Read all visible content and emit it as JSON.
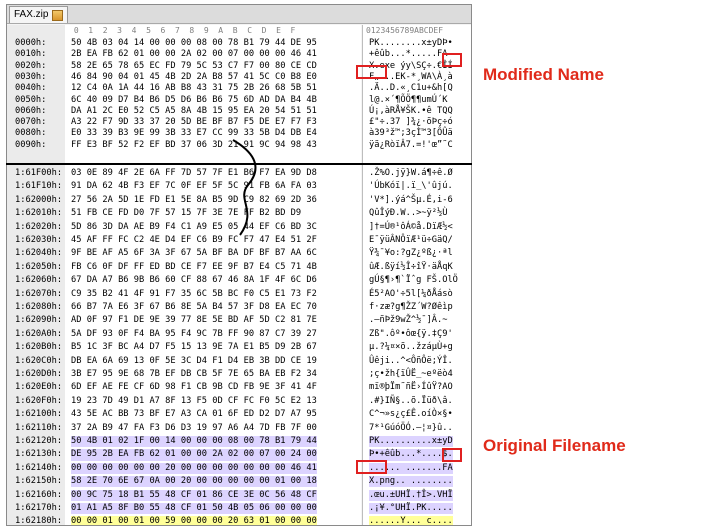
{
  "window": {
    "tab_title": "FAX.zip",
    "tab_icon": "archive-icon"
  },
  "header": {
    "offset_label": "",
    "hex_cols": " 0  1  2  3  4  5  6  7  8  9  A  B  C  D  E  F",
    "ascii_cols": "0123456789ABCDEF"
  },
  "top_rows": [
    {
      "offset": "0000h:",
      "hex": "50 4B 03 04 14 00 00 00 08 00 78 B1 79 44 DE 95",
      "ascii": "PK........x±yDÞ•"
    },
    {
      "offset": "0010h:",
      "hex": "2B EA FB 62 01 00 00 2A 02 00 07 00 00 00 46 41",
      "ascii": "+êûb...*.....FA"
    },
    {
      "offset": "0020h:",
      "hex": "58 2E 65 78 65 EC FD 79 5C 53 C7 F7 00 80 CE CD",
      "ascii": "X.exe ýy\\SÇ÷.€ÎÍ"
    },
    {
      "offset": "0030h:",
      "hex": "46 84 90 04 01 45 4B 2D 2A B8 57 41 5C C0 B8 E0",
      "ascii": "F„...EK-*¸WA\\À¸à"
    },
    {
      "offset": "0040h:",
      "hex": "12 C4 0A 1A 44 16 AB B8 43 31 75 2B 26 68 5B 51",
      "ascii": ".Ä..D.«¸C1u+&h[Q"
    },
    {
      "offset": "0050h:",
      "hex": "6C 40 09 D7 B4 B6 D5 D6 B6 B6 75 6D AD DA B4 4B",
      "ascii": "l@.×´¶ÕÖ¶¶um­Ú´K"
    },
    {
      "offset": "0060h:",
      "hex": "DA A1 2C E0 52 C5 A5 8A 4B 15 95 EA 20 54 51 51",
      "ascii": "Ú¡,àRÅ¥ŠK.•ê TQQ"
    },
    {
      "offset": "0070h:",
      "hex": "A3 22 F7 9D 33 37 20 5D BE BF B7 F5 DE E7 F7 F3",
      "ascii": "£\"÷.37 ]¾¿·õÞç÷ó"
    },
    {
      "offset": "0080h:",
      "hex": "E0 33 39 B3 9E 99 3B 33 E7 CC 99 33 5B D4 DB E4",
      "ascii": "à39³ž™;3çÌ™3[ÔÛä"
    },
    {
      "offset": "0090h:",
      "hex": "FF E3 BF 52 F2 EF BD 37 06 3D 21 91 9C 94 98 43",
      "ascii": "ÿã¿RòïÂ7.=!'œ”˜C"
    }
  ],
  "bottom_rows": [
    {
      "offset": "1:61F00h:",
      "hex": "03 0E 89 4F 2E 6A FF 7D 57 7F E1 B6 F7 EA 9D D8",
      "ascii": ".Ž%O.jÿ}W.á¶÷ê.Ø"
    },
    {
      "offset": "1:61F10h:",
      "hex": "91 DA 62 4B F3 EF 7C 0F EF 5F 5C 91 FB 6A FA 03",
      "ascii": "'ÚbKóï|.ï_\\'ûjú."
    },
    {
      "offset": "1:62000h:",
      "hex": "27 56 2A 5D 1E FD E1 5E 8A B5 9D C9 82 69 2D 36",
      "ascii": "'V*].ýá^Šµ.É‚i-6"
    },
    {
      "offset": "1:62010h:",
      "hex": "51 FB CE FD D0 7F 57 15 7F 3E 7E FF B2 BD D9",
      "ascii": "QûÎýÐ.W..>~ÿ²½Ù"
    },
    {
      "offset": "1:62020h:",
      "hex": "5D 86 3D DA AE B9 F4 C1 A9 E5 05 44 EF C6 BD 3C",
      "ascii": "]†=Ú®¹ôÁ©å.DïÆ½<"
    },
    {
      "offset": "1:62030h:",
      "hex": "45 AF FF FC C2 4E D4 EF C6 B9 FC F7 47 E4 51 2F",
      "ascii": "E¯ÿüÂNÔïÆ¹ü÷GäQ/"
    },
    {
      "offset": "1:62040h:",
      "hex": "9F BE AF A5 6F 3A 3F 67 5A BF BA DF BF B7 AA 6C",
      "ascii": "Ÿ¾¯¥o:?gZ¿ºß¿·ªl"
    },
    {
      "offset": "1:62050h:",
      "hex": "FB C6 0F DF FF ED BD CE F7 EE 9F B7 E4 C5 71 4B",
      "ascii": "ûÆ.ßÿí½Î÷îŸ·äÅqK"
    },
    {
      "offset": "1:62060h:",
      "hex": "67 DA A7 B6 9B B6 60 CF 88 67 46 8A 1F 4F 6C D6",
      "ascii": "gÚ§¶›¶`Ïˆg FŠ.OlÖ"
    },
    {
      "offset": "1:62070h:",
      "hex": "C9 35 B2 41 4F 91 F7 35 6C 5B BC F0 C5 E1 73 F2",
      "ascii": "É5²AO'÷5l[¼ðÅásò"
    },
    {
      "offset": "1:62080h:",
      "hex": "66 B7 7A E6 3F 67 B6 8E 5A B4 57 3F D8 EA EC 70",
      "ascii": "f·zæ?g¶ŽZ´W?Øêìp"
    },
    {
      "offset": "1:62090h:",
      "hex": "AD 0F 97 F1 DE 9E 39 77 8E 5E BD AF 5D C2 81 7E",
      "ascii": "­.—ñÞž9wŽ^½¯]Â.~"
    },
    {
      "offset": "1:620A0h:",
      "hex": "5A DF 93 0F F4 BA 95 F4 9C 7B FF 90 87 C7 39 27",
      "ascii": "Zß\".ôº•ôœ{ÿ.‡Ç9'"
    },
    {
      "offset": "1:620B0h:",
      "hex": "B5 1C 3F BC A4 D7 F5 15 13 9E 7A E1 B5 D9 2B 67",
      "ascii": "µ.?¼¤×õ..žzáµÙ+g"
    },
    {
      "offset": "1:620C0h:",
      "hex": "DB EA 6A 69 13 0F 5E 3C D4 F1 D4 EB 3B DD CE 19",
      "ascii": "Ûêji..^<ÔñÔë;ÝÎ."
    },
    {
      "offset": "1:620D0h:",
      "hex": "3B E7 95 9E 68 7B EF DB CB 5F 7E 65 BA EB F2 34",
      "ascii": ";ç•žh{ïÛË_~eºëò4"
    },
    {
      "offset": "1:620E0h:",
      "hex": "6D EF AE FE CF 6D 98 F1 CB 9B CD FB 9E 3F 41 4F",
      "ascii": "mï®þÏm˜ñË›ÍûŸ?AO"
    },
    {
      "offset": "1:620F0h:",
      "hex": "19 23 7D 49 D1 A7 8F 13 F5 0D CF FC F0 5C E2 13",
      "ascii": ".#}IÑ§..õ.Ïüð\\â."
    },
    {
      "offset": "1:62100h:",
      "hex": "43 5E AC BB 73 BF E7 A3 CA 01 6F ED D2 D7 A7 95",
      "ascii": "C^¬»s¿ç£Ê.oíÒ×§•"
    },
    {
      "offset": "1:62110h:",
      "hex": "37 2A B9 47 FA F3 D6 D3 19 97 A6 A4 7D FB 7F 00",
      "ascii": "7*¹GúóÖÓ.—¦¤}û.."
    },
    {
      "offset": "1:62120h:",
      "hex": "50 4B 01 02 1F 00 14 00 00 00 08 00 78 B1 79 44",
      "ascii": "PK..........x±yD"
    },
    {
      "offset": "1:62130h:",
      "hex": "DE 95 2B EA FB 62 01 00 00 2A 02 00 07 00 24 00",
      "ascii": "Þ•+êûb...*....$."
    },
    {
      "offset": "1:62140h:",
      "hex": "00 00 00 00 00 00 20 00 00 00 00 00 00 00 46 41",
      "ascii": "...... .......FA"
    },
    {
      "offset": "1:62150h:",
      "hex": "58 2E 70 6E 67 0A 00 20 00 00 00 00 00 01 00 18",
      "ascii": "X.png.. ........"
    },
    {
      "offset": "1:62160h:",
      "hex": "00 9C 75 18 B1 55 48 CF 01 86 CE 3E 0C 56 48 CF",
      "ascii": ".œu.±UHÏ.†Î>.VHÏ"
    },
    {
      "offset": "1:62170h:",
      "hex": "01 A1 A5 8F B0 55 48 CF 01 50 4B 05 06 00 00 00",
      "ascii": ".¡¥.°UHÏ.PK....."
    },
    {
      "offset": "1:62180h:",
      "hex": "00 00 01 00 01 00 59 00 00 00 20 63 01 00 00 00",
      "ascii": "......Y... c...."
    }
  ],
  "annotations": {
    "modified": "Modified Name",
    "original": "Original Filename"
  },
  "colors": {
    "accent": "#e02a1a",
    "highlight": "#ffff99",
    "selection": "#dcd3ff"
  }
}
